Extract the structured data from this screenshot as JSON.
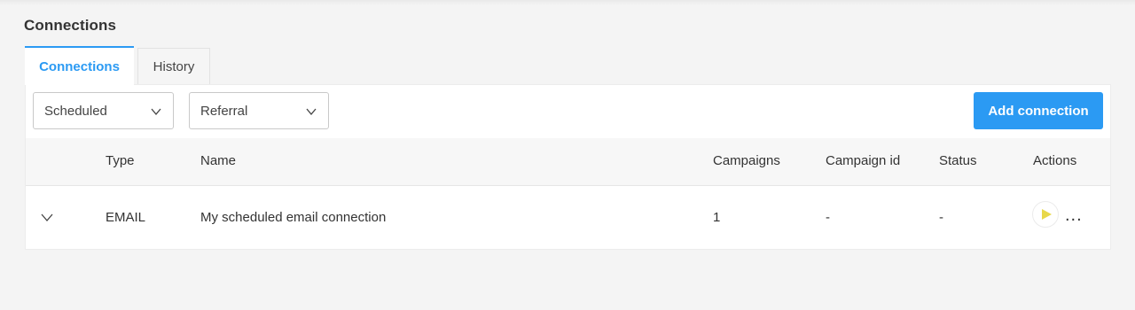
{
  "page": {
    "title": "Connections"
  },
  "tabs": [
    {
      "label": "Connections",
      "active": true
    },
    {
      "label": "History",
      "active": false
    }
  ],
  "filters": {
    "status_value": "Scheduled",
    "type_value": "Referral"
  },
  "toolbar": {
    "add_label": "Add connection"
  },
  "table": {
    "columns": [
      "Type",
      "Name",
      "Campaigns",
      "Campaign id",
      "Status",
      "Actions"
    ],
    "rows": [
      {
        "type": "EMAIL",
        "name": "My scheduled email connection",
        "campaigns": "1",
        "campaign_id": "-",
        "status": "-",
        "more": "..."
      }
    ]
  },
  "icons": {
    "expand": "chevron-down-icon",
    "dropdown": "chevron-down-icon",
    "run": "play-icon",
    "more": "more-dots-icon"
  },
  "colors": {
    "accent": "#2b9af3",
    "play": "#e8d84a",
    "background": "#f4f4f4"
  }
}
